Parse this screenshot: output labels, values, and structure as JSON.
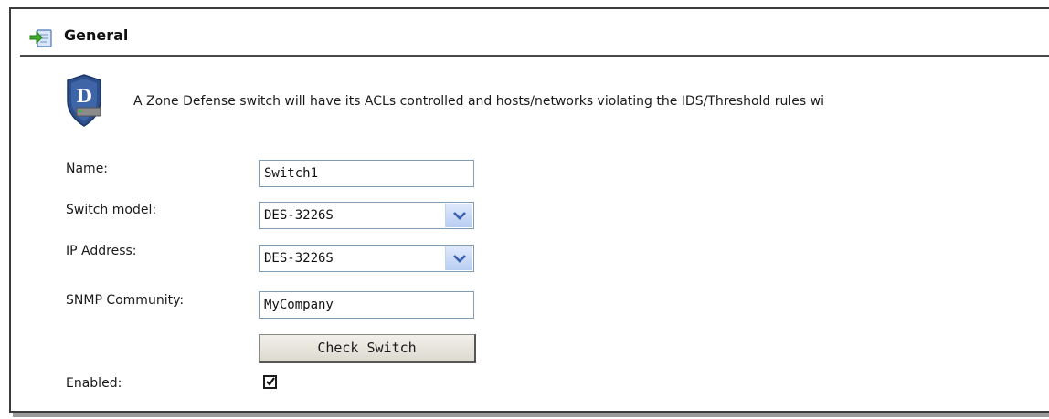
{
  "section": {
    "title": "General",
    "icon": "edit-arrow-icon"
  },
  "description": {
    "icon": "d-link-shield-icon",
    "text": "A Zone Defense switch will have its ACLs controlled and hosts/networks violating the IDS/Threshold rules wi"
  },
  "form": {
    "name_label": "Name:",
    "name_value": "Switch1",
    "switch_model_label": "Switch model:",
    "switch_model_value": "DES-3226S",
    "ip_address_label": "IP Address:",
    "ip_address_value": "DES-3226S",
    "snmp_label": "SNMP Community:",
    "snmp_value": "MyCompany",
    "check_switch_label": "Check Switch",
    "enabled_label": "Enabled:",
    "enabled_checked": true
  },
  "colors": {
    "dropdown_arrow": "#3a5fb0",
    "input_border": "#7f9db9",
    "shield": "#2e4f8a"
  }
}
